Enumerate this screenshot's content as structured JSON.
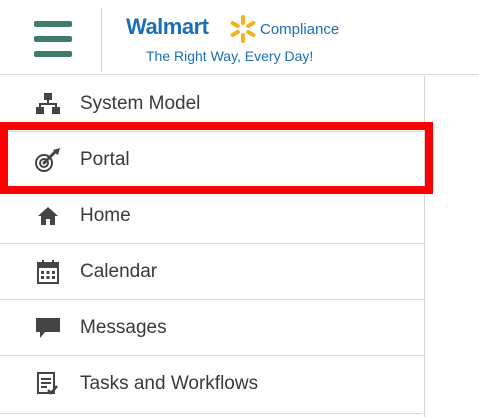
{
  "header": {
    "menu_toggle_icon": "hamburger-icon",
    "logo": {
      "brand": "Walmart",
      "suffix": "Compliance",
      "tagline": "The Right Way, Every Day!",
      "brand_color": "#1c6fb4",
      "spark_color": "#f5b21a"
    }
  },
  "menu": {
    "items": [
      {
        "label": "System Model",
        "icon": "hierarchy-icon"
      },
      {
        "label": "Portal",
        "icon": "target-dart-icon"
      },
      {
        "label": "Home",
        "icon": "home-icon"
      },
      {
        "label": "Calendar",
        "icon": "calendar-icon"
      },
      {
        "label": "Messages",
        "icon": "message-icon"
      },
      {
        "label": "Tasks and Workflows",
        "icon": "task-list-icon"
      }
    ]
  },
  "colors": {
    "accent_green": "#3f7c6b",
    "highlight_red": "#ff0000",
    "icon_gray": "#444444"
  }
}
